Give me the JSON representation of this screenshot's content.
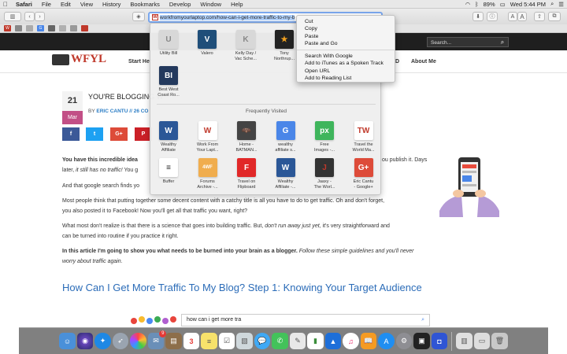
{
  "menubar": {
    "app": "Safari",
    "items": [
      "File",
      "Edit",
      "View",
      "History",
      "Bookmarks",
      "Develop",
      "Window",
      "Help"
    ],
    "battery": "89%",
    "clock": "Wed 5:44 PM"
  },
  "toolbar": {
    "url": "workfromyourlaptop.com/how-can-i-get-more-traffic-to-my-b",
    "font_small": "A",
    "font_large": "A"
  },
  "site": {
    "logo_text": "WFYL",
    "nav_start": "Start Her",
    "nav_fragment": "D",
    "nav_about": "About Me",
    "search_placeholder": "Search..."
  },
  "post": {
    "day": "21",
    "month": "Mar",
    "title": "YOU'RE BLOGGING W",
    "byline_prefix": "BY",
    "author": "ERIC CANTU",
    "comments": "// 26 CO",
    "share": [
      "f",
      "t",
      "G+",
      "P"
    ]
  },
  "article": {
    "p1_a": "You have this incredible idea",
    "p1_b": "ou publish it. Days",
    "p1_c": "later, ",
    "p1_c_em": "it still has no traffic!",
    "p1_c_tail": " You g",
    "p2": "And that google search finds yo",
    "p3_a": "Most people think that putting together some decent content with a catchy title is all you have to do to get traffic. Oh and don't forget,",
    "p3_b": "you also posted it to Facebook! Now you'll get all that traffic you want, right?",
    "p4_a": "What most don't realize is that there is a science that goes into building traffic. But, ",
    "p4_a_em": "don't run away just yet,",
    "p4_a_tail": " it's very straightforward and",
    "p4_b": "can be turned into routine if you practice it right.",
    "p5_bold": "In this article I'm going to show you what needs to be burned into your brain as a blogger.",
    "p5_em": " Follow these simple guidelines and you'll never",
    "p5_em2": "worry about traffic again.",
    "h2": "How Can I Get More Traffic To My Blog? Step 1: Knowing Your Target Audience",
    "thumb_search": "how can i get more tra"
  },
  "favorites": {
    "top": [
      {
        "label1": "Utility Bill",
        "label2": "",
        "glyph": "U",
        "color": "#d8d8d8",
        "fg": "#888"
      },
      {
        "label1": "Valero",
        "label2": "",
        "glyph": "V",
        "color": "#1f4e79",
        "fg": "#fff"
      },
      {
        "label1": "Kelly Day /",
        "label2": "Vac Sche...",
        "glyph": "K",
        "color": "#d8d8d8",
        "fg": "#888"
      },
      {
        "label1": "Tony",
        "label2": "Northrup...",
        "glyph": "★",
        "color": "#222",
        "fg": "#f0a020"
      },
      {
        "label1": "Best West",
        "label2": "Coast Ro...",
        "glyph": "BI",
        "color": "#23395d",
        "fg": "#fff"
      }
    ],
    "section_title": "Frequently Visited",
    "frequent": [
      {
        "label1": "Wealthy",
        "label2": "Affiliate",
        "glyph": "W",
        "color": "#2b5797",
        "fg": "#fff"
      },
      {
        "label1": "Work From",
        "label2": "Your Lapt...",
        "glyph": "W",
        "color": "#fff",
        "fg": "#c0392b"
      },
      {
        "label1": "Home -",
        "label2": "BATMAN...",
        "glyph": "🦇",
        "color": "#444",
        "fg": "#fff"
      },
      {
        "label1": "wealthy",
        "label2": "affiliate s...",
        "glyph": "G",
        "color": "#4a86e8",
        "fg": "#fff"
      },
      {
        "label1": "Free",
        "label2": "Images -...",
        "glyph": "px",
        "color": "#3fb55c",
        "fg": "#fff"
      },
      {
        "label1": "Travel the",
        "label2": "World Ma...",
        "glyph": "TW",
        "color": "#fff",
        "fg": "#c0392b"
      },
      {
        "label1": "Buffer",
        "label2": "",
        "glyph": "≡",
        "color": "#fff",
        "fg": "#222"
      },
      {
        "label1": "Forums",
        "label2": "Archive -...",
        "glyph": "4WF",
        "color": "#f0ad4e",
        "fg": "#fff"
      },
      {
        "label1": "Travel on",
        "label2": "Flipboard",
        "glyph": "F",
        "color": "#e12828",
        "fg": "#fff"
      },
      {
        "label1": "Wealthy",
        "label2": "Affiliate -...",
        "glyph": "W",
        "color": "#2b5797",
        "fg": "#fff"
      },
      {
        "label1": "Jaaxy -",
        "label2": "The Worl...",
        "glyph": "J",
        "color": "#333",
        "fg": "#c0392b"
      },
      {
        "label1": "Eric Cantu",
        "label2": "- Google+",
        "glyph": "G+",
        "color": "#dd4b39",
        "fg": "#fff"
      }
    ]
  },
  "context_menu": {
    "group1": [
      "Cut",
      "Copy",
      "Paste",
      "Paste and Go"
    ],
    "group2": [
      "Search With Google",
      "Add to iTunes as a Spoken Track",
      "Open URL",
      "Add to Reading List"
    ]
  },
  "dock": {
    "calendar_day": "3",
    "badge": "9"
  }
}
